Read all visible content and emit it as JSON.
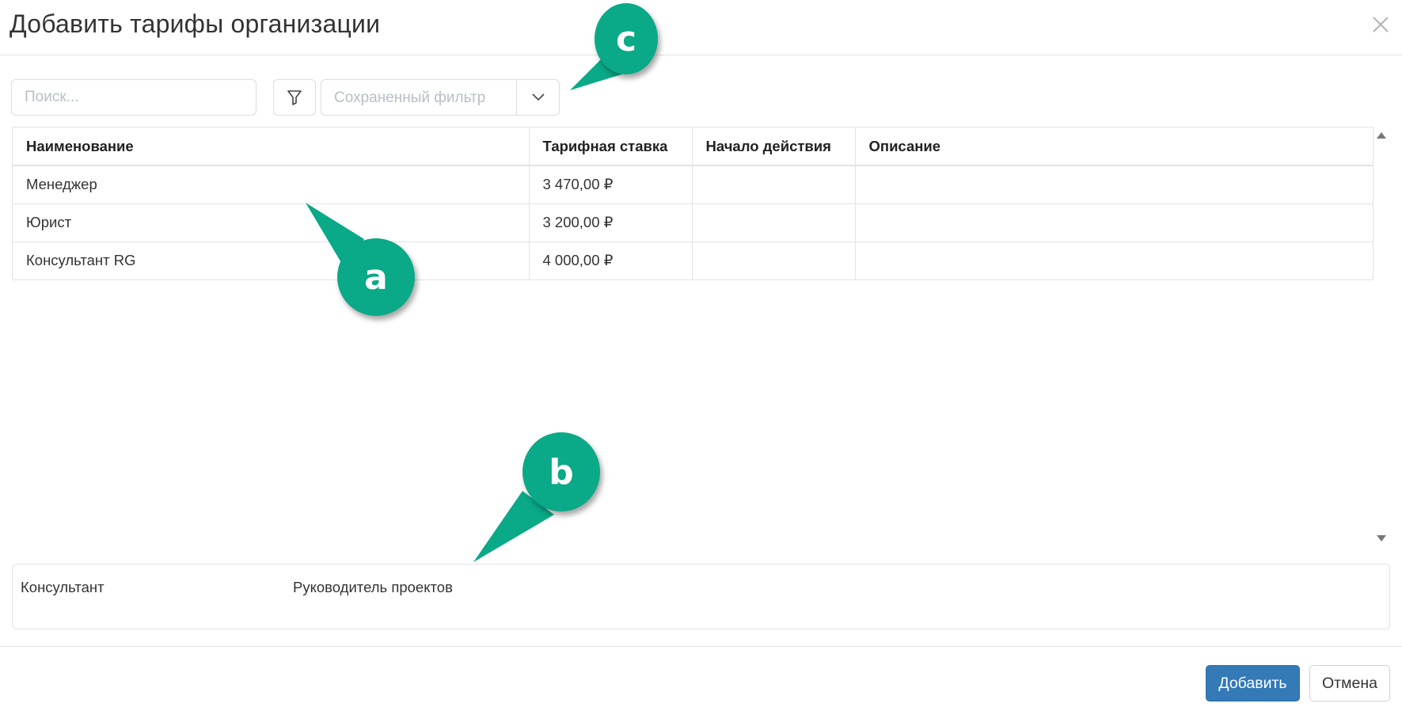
{
  "dialog": {
    "title": "Добавить тарифы организации",
    "close_icon": "close-icon"
  },
  "toolbar": {
    "search_placeholder": "Поиск...",
    "filter_icon": "funnel-icon",
    "saved_filter_placeholder": "Сохраненный фильтр",
    "dropdown_icon": "chevron-down-icon"
  },
  "table": {
    "columns": [
      "Наименование",
      "Тарифная ставка",
      "Начало действия",
      "Описание"
    ],
    "rows": [
      {
        "name": "Менеджер",
        "rate": "3 470,00 ₽",
        "start": "",
        "description": ""
      },
      {
        "name": "Юрист",
        "rate": "3 200,00 ₽",
        "start": "",
        "description": ""
      },
      {
        "name": "Консультант RG",
        "rate": "4 000,00 ₽",
        "start": "",
        "description": ""
      }
    ]
  },
  "selected": {
    "items": [
      "Консультант",
      "Руководитель проектов"
    ]
  },
  "footer": {
    "add_label": "Добавить",
    "cancel_label": "Отмена"
  },
  "callouts": {
    "a": "a",
    "b": "b",
    "c": "c",
    "color": "#0aa987"
  },
  "colors": {
    "primary": "#337ab7",
    "border": "#e3e3e3"
  }
}
